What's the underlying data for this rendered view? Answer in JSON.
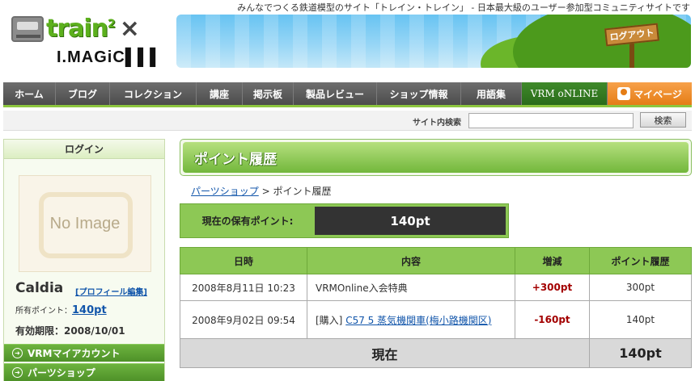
{
  "header": {
    "tagline": "みんなでつくる鉄道模型のサイト「トレイン・トレイン」 - 日本最大級のユーザー参加型コミュニティサイトです",
    "logo": {
      "train": "train",
      "sup": "2",
      "cross": "×",
      "imagic": "I.MAGiC▌▌▌"
    },
    "logout_label": "ログアウト"
  },
  "nav": {
    "items": [
      {
        "label": "ホーム"
      },
      {
        "label": "ブログ"
      },
      {
        "label": "コレクション"
      },
      {
        "label": "講座"
      },
      {
        "label": "掲示板"
      },
      {
        "label": "製品レビュー"
      },
      {
        "label": "ショップ情報"
      },
      {
        "label": "用語集"
      },
      {
        "label": "VRM oNLINE"
      },
      {
        "label": "マイページ"
      }
    ]
  },
  "search": {
    "label": "サイト内検索",
    "value": "",
    "button": "検索"
  },
  "sidebar": {
    "login_heading": "ログイン",
    "no_image": "No Image",
    "username": "Caldia",
    "profile_edit": "[プロフィール編集]",
    "points_label": "所有ポイント：",
    "points_value": "140pt",
    "expire_label": "有効期限：",
    "expire_value": "2008/10/01",
    "links": [
      {
        "label": "VRMマイアカウント"
      },
      {
        "label": "パーツショップ"
      }
    ]
  },
  "main": {
    "title": "ポイント履歴",
    "breadcrumb": {
      "link": "パーツショップ",
      "sep": ">",
      "current": "ポイント履歴"
    },
    "current_points": {
      "label": "現在の保有ポイント:",
      "value": "140pt"
    },
    "table": {
      "headers": [
        "日時",
        "内容",
        "増減",
        "ポイント履歴"
      ],
      "rows": [
        {
          "date": "2008年8月11日 10:23",
          "prefix": "",
          "content": "VRMOnline入会特典",
          "change": "+300pt",
          "balance": "300pt"
        },
        {
          "date": "2008年9月02日 09:54",
          "prefix": "[購入]",
          "content": "C57 5 蒸気機関車(梅小路機関区)",
          "change": "-160pt",
          "balance": "140pt"
        }
      ],
      "total_label": "現在",
      "total_value": "140pt"
    }
  }
}
